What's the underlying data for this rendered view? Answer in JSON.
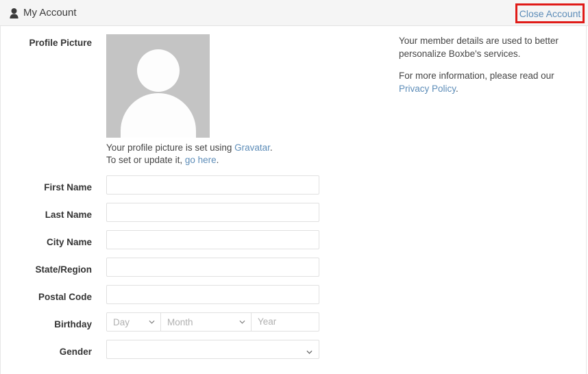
{
  "header": {
    "icon": "user-icon",
    "title": "My Account",
    "close_account_label": "Close Account",
    "highlight_color": "#e01b18",
    "link_color": "#5c8cb8",
    "background": "#f5f5f5"
  },
  "info": {
    "paragraph1": "Your member details are used to better personalize Boxbe's services.",
    "paragraph2_prefix": "For more information, please read our ",
    "privacy_policy_label": "Privacy Policy",
    "paragraph2_suffix": "."
  },
  "profile": {
    "label": "Profile Picture",
    "avatar_placeholder_color": "#c4c4c4",
    "caption_line1_prefix": "Your profile picture is set using ",
    "gravatar_label": "Gravatar",
    "caption_line1_suffix": ".",
    "caption_line2_prefix": "To set or update it, ",
    "go_here_label": "go here",
    "caption_line2_suffix": "."
  },
  "form": {
    "fields": [
      {
        "label": "First Name",
        "type": "text",
        "value": "",
        "placeholder": ""
      },
      {
        "label": "Last Name",
        "type": "text",
        "value": "",
        "placeholder": ""
      },
      {
        "label": "City Name",
        "type": "text",
        "value": "",
        "placeholder": ""
      },
      {
        "label": "State/Region",
        "type": "text",
        "value": "",
        "placeholder": ""
      },
      {
        "label": "Postal Code",
        "type": "text",
        "value": "",
        "placeholder": ""
      }
    ],
    "birthday": {
      "label": "Birthday",
      "day_placeholder": "Day",
      "month_placeholder": "Month",
      "year_placeholder": "Year",
      "day_value": "",
      "month_value": "",
      "year_value": ""
    },
    "gender": {
      "label": "Gender",
      "value": ""
    }
  }
}
